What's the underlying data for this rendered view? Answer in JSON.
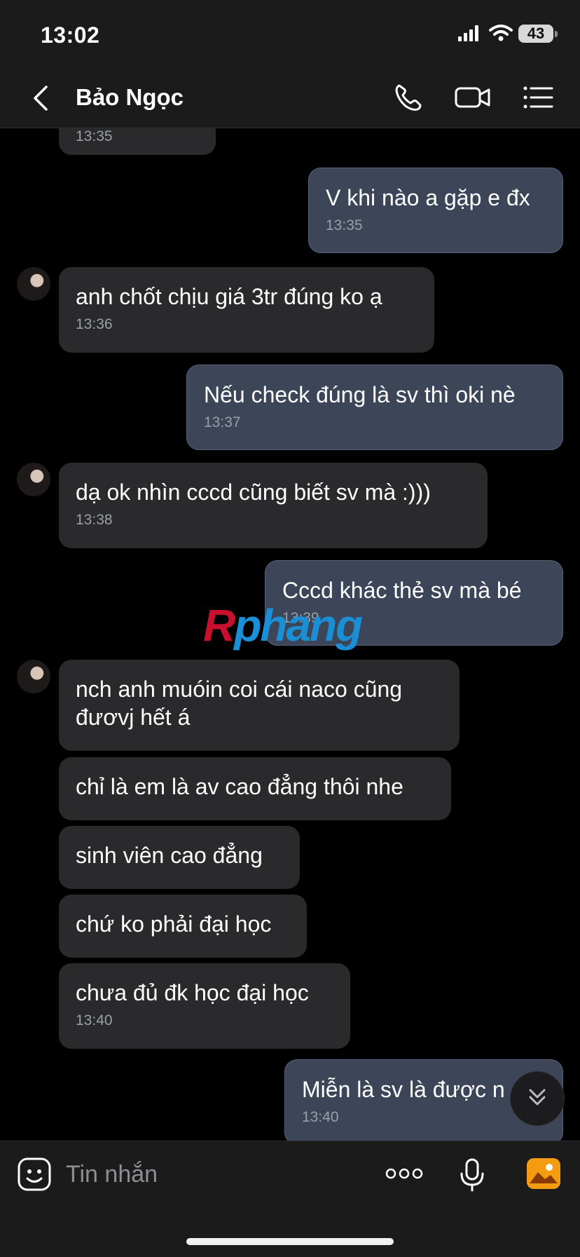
{
  "status_bar": {
    "time": "13:02",
    "battery": "43"
  },
  "header": {
    "contact_name": "Bảo Ngọc"
  },
  "messages": [
    {
      "id": "m0",
      "dir": "in",
      "text": "",
      "time": "13:35"
    },
    {
      "id": "m1",
      "dir": "out",
      "text": "V khi nào a gặp e đx",
      "time": "13:35"
    },
    {
      "id": "m2",
      "dir": "in",
      "text": "anh chốt chịu giá 3tr đúng ko ạ",
      "time": "13:36"
    },
    {
      "id": "m3",
      "dir": "out",
      "text": "Nếu check đúng là sv thì oki nè",
      "time": "13:37"
    },
    {
      "id": "m4",
      "dir": "in",
      "text": "dạ ok nhìn cccd cũng biết sv mà :)))",
      "time": "13:38"
    },
    {
      "id": "m5",
      "dir": "out",
      "text": "Cccd khác thẻ sv mà bé",
      "time": "13:39"
    },
    {
      "id": "m6",
      "dir": "in",
      "text": "nch anh muóin coi cái naco cũng đươvj hết á",
      "time": ""
    },
    {
      "id": "m7",
      "dir": "in",
      "text": "chỉ là em là av cao đẳng thôi nhe",
      "time": ""
    },
    {
      "id": "m8",
      "dir": "in",
      "text": "sinh viên cao đẳng",
      "time": ""
    },
    {
      "id": "m9",
      "dir": "in",
      "text": "chứ ko phải đại học",
      "time": ""
    },
    {
      "id": "m10",
      "dir": "in",
      "text": "chưa đủ đk học đại học",
      "time": "13:40"
    },
    {
      "id": "m11",
      "dir": "out",
      "text": "Miễn là sv là được n",
      "time": "13:40"
    }
  ],
  "watermark": {
    "first_letter": "R",
    "rest": "phang"
  },
  "input": {
    "placeholder": "Tin nhắn"
  },
  "icons": {
    "back": "chevron-left-icon",
    "call": "phone-icon",
    "video": "video-camera-icon",
    "menu": "list-menu-icon",
    "sticker": "smiley-sticker-icon",
    "more": "more-dots-icon",
    "mic": "microphone-icon",
    "photo": "photo-icon",
    "scroll": "double-chevron-down-icon"
  },
  "colors": {
    "outgoing_bubble": "#3c4658",
    "incoming_bubble": "#2a2a2c",
    "photo_icon": "#f39c12"
  }
}
